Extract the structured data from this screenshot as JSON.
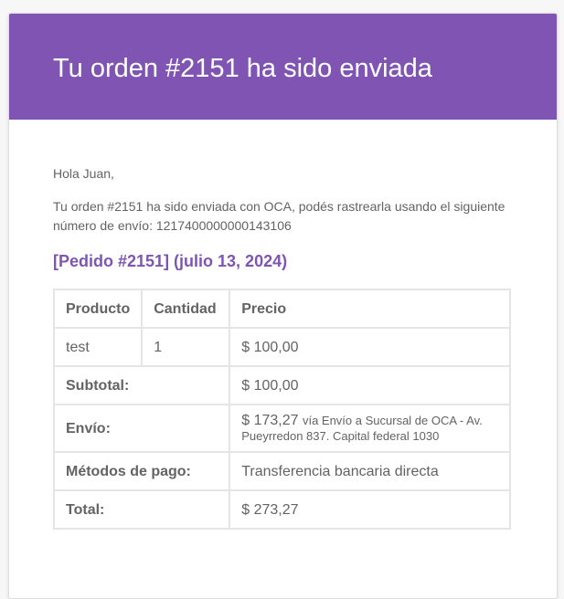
{
  "email": {
    "title": "Tu orden #2151 ha sido enviada",
    "greeting": "Hola Juan,",
    "message": "Tu orden #2151 ha sido enviada con OCA, podés rastrearla usando el siguiente número de envío: 1217400000000143106",
    "order_heading": "[Pedido #2151] (julio 13, 2024)"
  },
  "colors": {
    "brand": "#7f54b3",
    "text": "#636363",
    "border": "#e5e5e5"
  },
  "table": {
    "headers": {
      "product": "Producto",
      "quantity": "Cantidad",
      "price": "Precio"
    },
    "items": [
      {
        "product": "test",
        "quantity": "1",
        "price": "$ 100,00"
      }
    ],
    "totals": {
      "subtotal_label": "Subtotal:",
      "subtotal_value": "$ 100,00",
      "shipping_label": "Envío:",
      "shipping_amount": "$ 173,27",
      "shipping_method": "vía Envío a Sucursal de OCA - Av. Pueyrredon 837. Capital federal 1030",
      "payment_label": "Métodos de pago:",
      "payment_value": "Transferencia bancaria directa",
      "total_label": "Total:",
      "total_value": "$ 273,27"
    }
  }
}
